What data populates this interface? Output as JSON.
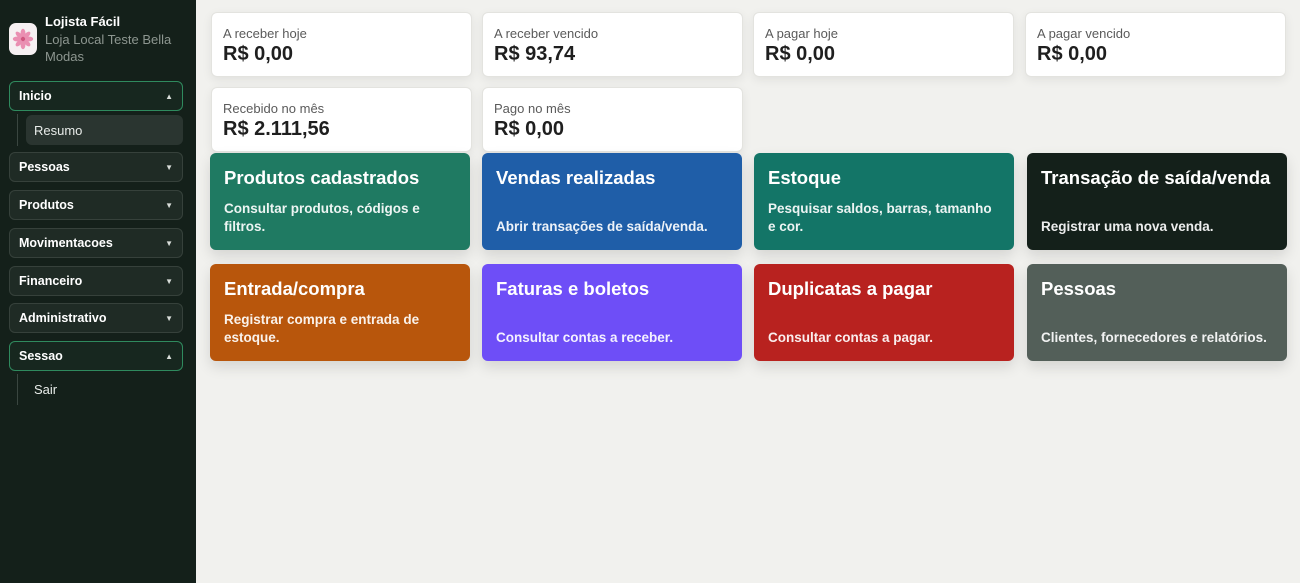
{
  "brand": {
    "title": "Lojista Fácil",
    "subtitle": "Loja Local Teste Bella Modas",
    "logo_icon": "flower-icon"
  },
  "sidebar": {
    "menus": [
      {
        "label": "Inicio",
        "open": true,
        "submenu": [
          "Resumo"
        ]
      },
      {
        "label": "Pessoas",
        "open": false
      },
      {
        "label": "Produtos",
        "open": false
      },
      {
        "label": "Movimentacoes",
        "open": false
      },
      {
        "label": "Financeiro",
        "open": false
      },
      {
        "label": "Administrativo",
        "open": false
      },
      {
        "label": "Sessao",
        "open": true,
        "submenu": [
          "Sair"
        ]
      }
    ],
    "caret_open": "▲",
    "caret_closed": "▼"
  },
  "summary": [
    {
      "label": "A receber hoje",
      "value": "R$ 0,00"
    },
    {
      "label": "A receber vencido",
      "value": "R$ 93,74"
    },
    {
      "label": "A pagar hoje",
      "value": "R$ 0,00"
    },
    {
      "label": "A pagar vencido",
      "value": "R$ 0,00"
    },
    {
      "label": "Recebido no mês",
      "value": "R$ 2.111,56"
    },
    {
      "label": "Pago no mês",
      "value": "R$ 0,00"
    }
  ],
  "tiles": [
    {
      "title": "Produtos cadastrados",
      "desc": "Consultar produtos, códigos e filtros.",
      "color": "#1f7a62"
    },
    {
      "title": "Vendas realizadas",
      "desc": "Abrir transações de saída/venda.",
      "color": "#1f5ea8"
    },
    {
      "title": "Estoque",
      "desc": "Pesquisar saldos, barras, tamanho e cor.",
      "color": "#137567"
    },
    {
      "title": "Transação de saída/venda",
      "desc": "Registrar uma nova venda.",
      "color": "#14201a"
    },
    {
      "title": "Entrada/compra",
      "desc": "Registrar compra e entrada de estoque.",
      "color": "#b8560c"
    },
    {
      "title": "Faturas e boletos",
      "desc": "Consultar contas a receber.",
      "color": "#6e4ef7"
    },
    {
      "title": "Duplicatas a pagar",
      "desc": "Consultar contas a pagar.",
      "color": "#b8221f"
    },
    {
      "title": "Pessoas",
      "desc": "Clientes, fornecedores e relatórios.",
      "color": "#535f59"
    }
  ]
}
